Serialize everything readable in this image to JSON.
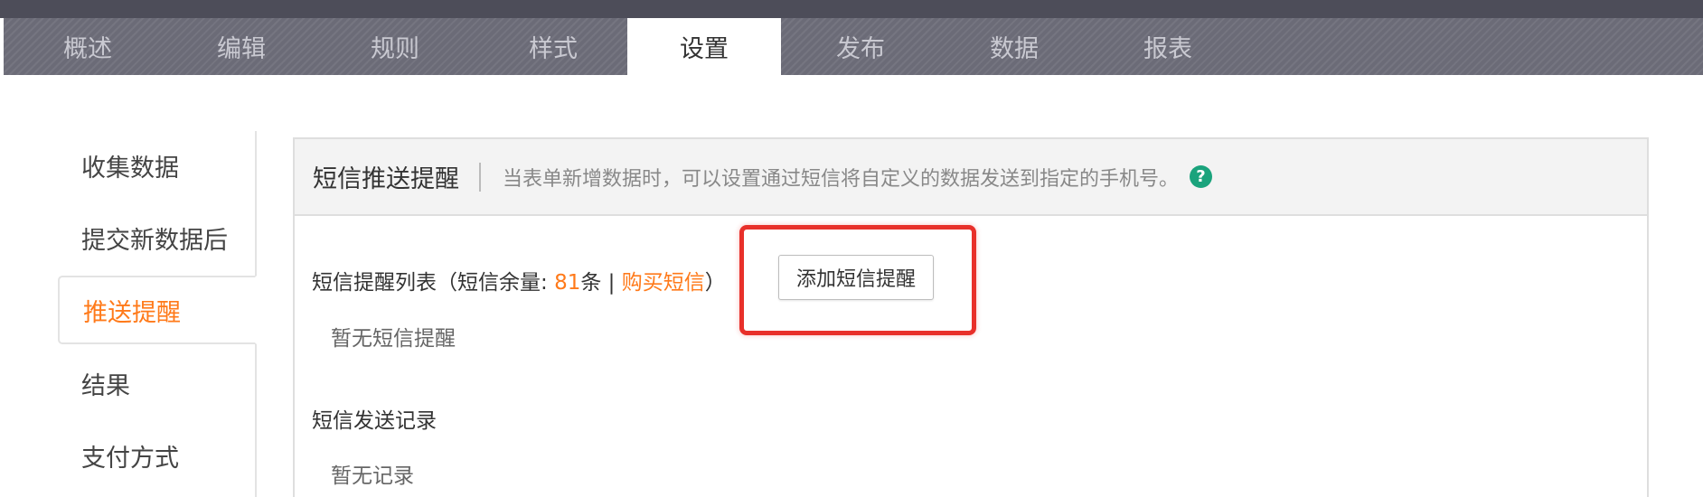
{
  "tabs": [
    {
      "label": "概述"
    },
    {
      "label": "编辑"
    },
    {
      "label": "规则"
    },
    {
      "label": "样式"
    },
    {
      "label": "设置",
      "active": true
    },
    {
      "label": "发布"
    },
    {
      "label": "数据"
    },
    {
      "label": "报表"
    }
  ],
  "sidebar": {
    "items": [
      {
        "label": "收集数据"
      },
      {
        "label": "提交新数据后"
      },
      {
        "label": "推送提醒",
        "active": true
      },
      {
        "label": "结果"
      },
      {
        "label": "支付方式"
      }
    ]
  },
  "panel": {
    "title": "短信推送提醒",
    "description": "当表单新增数据时，可以设置通过短信将自定义的数据发送到指定的手机号。",
    "help_icon": "question-circle-icon"
  },
  "sms_list": {
    "label_prefix": "短信提醒列表（短信余量: ",
    "balance": "81",
    "unit": "条 | ",
    "buy_link": "购买短信",
    "label_suffix": "）",
    "add_button": "添加短信提醒",
    "empty": "暂无短信提醒"
  },
  "sms_log": {
    "label": "短信发送记录",
    "empty": "暂无记录"
  },
  "colors": {
    "accent": "#ff7a1a",
    "highlight": "#e8302a",
    "help": "#1aa37c"
  }
}
